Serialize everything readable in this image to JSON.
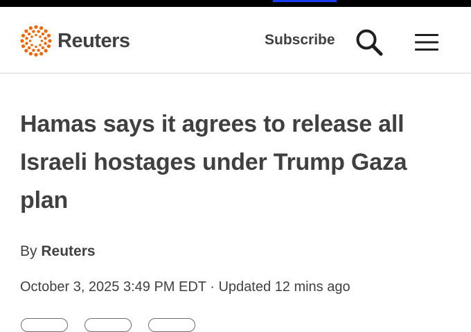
{
  "colors": {
    "top_strip": "#000000",
    "top_strip_accent": "#1a3cf0",
    "text": "#404040",
    "logo_orange": "#fa6400",
    "divider": "#d4d4d4"
  },
  "header": {
    "logo_text": "Reuters",
    "logo_icon": "reuters-dot-ring-icon",
    "subscribe_label": "Subscribe",
    "search_icon": "search-icon",
    "menu_icon": "hamburger-menu-icon"
  },
  "article": {
    "headline": "Hamas says it agrees to release all Israeli hostages under Trump Gaza plan",
    "byline_prefix": "By",
    "byline_author": "Reuters",
    "date": "October 3, 2025 3:49 PM EDT",
    "separator": "·",
    "updated": "Updated 12 mins ago"
  },
  "share_buttons_count": 3
}
